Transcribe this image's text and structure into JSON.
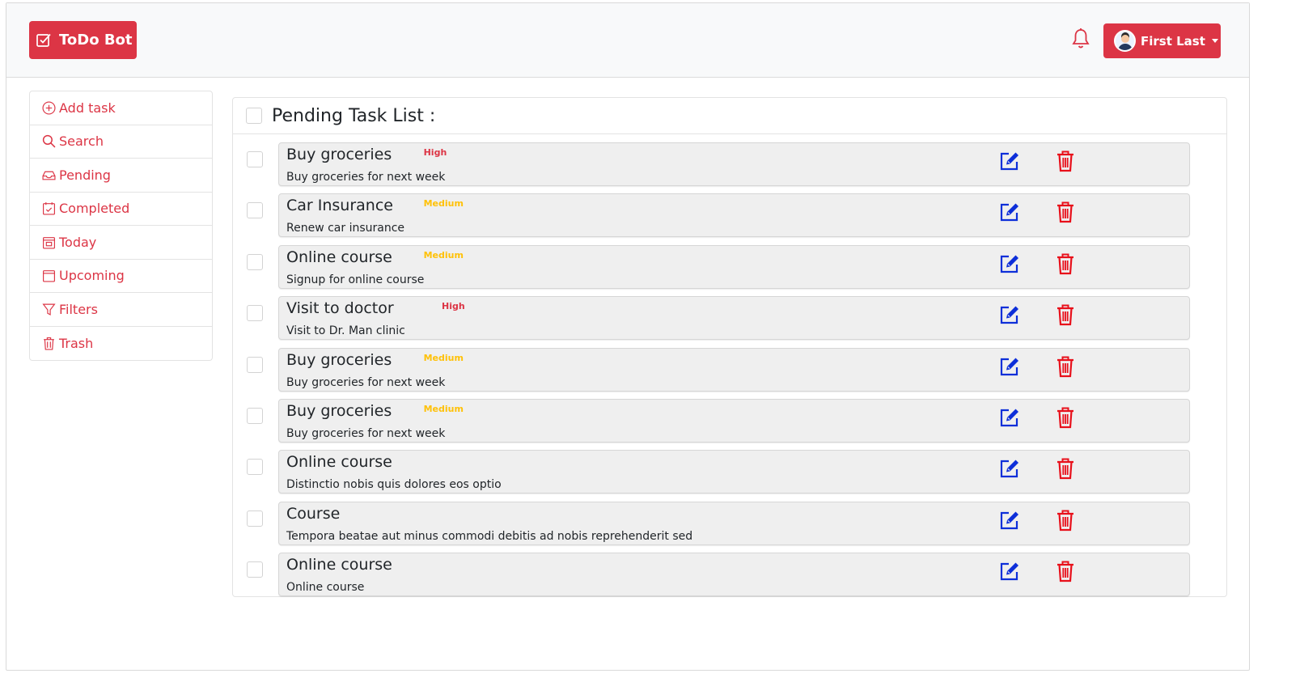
{
  "app": {
    "brand_label": "ToDo Bot"
  },
  "header": {
    "user_name": "First Last"
  },
  "sidebar": {
    "items": [
      {
        "label": "Add task",
        "icon": "plus-circle-icon"
      },
      {
        "label": "Search",
        "icon": "search-icon"
      },
      {
        "label": "Pending",
        "icon": "inbox-icon"
      },
      {
        "label": "Completed",
        "icon": "calendar-check-icon"
      },
      {
        "label": "Today",
        "icon": "calendar-day-icon"
      },
      {
        "label": "Upcoming",
        "icon": "calendar-icon"
      },
      {
        "label": "Filters",
        "icon": "funnel-icon"
      },
      {
        "label": "Trash",
        "icon": "trash-icon"
      }
    ]
  },
  "main": {
    "title": "Pending Task List :",
    "tasks": [
      {
        "title": "Buy groceries",
        "priority": "High",
        "description": "Buy groceries for next week"
      },
      {
        "title": "Car Insurance",
        "priority": "Medium",
        "description": "Renew car insurance"
      },
      {
        "title": "Online course",
        "priority": "Medium",
        "description": "Signup for online course"
      },
      {
        "title": "Visit to doctor",
        "priority": "High",
        "description": "Visit to Dr. Man clinic"
      },
      {
        "title": "Buy groceries",
        "priority": "Medium",
        "description": "Buy groceries for next week"
      },
      {
        "title": "Buy groceries",
        "priority": "Medium",
        "description": "Buy groceries for next week"
      },
      {
        "title": "Online course",
        "priority": "",
        "description": "Distinctio nobis quis dolores eos optio"
      },
      {
        "title": "Course",
        "priority": "",
        "description": "Tempora beatae aut minus commodi debitis ad nobis reprehenderit sed"
      },
      {
        "title": "Online course",
        "priority": "",
        "description": "Online course"
      }
    ]
  },
  "colors": {
    "brand": "#dc3545",
    "priority_high": "#dc3545",
    "priority_medium": "#ffc107",
    "edit_icon": "#0d2fd9",
    "delete_icon": "#e8101b"
  }
}
